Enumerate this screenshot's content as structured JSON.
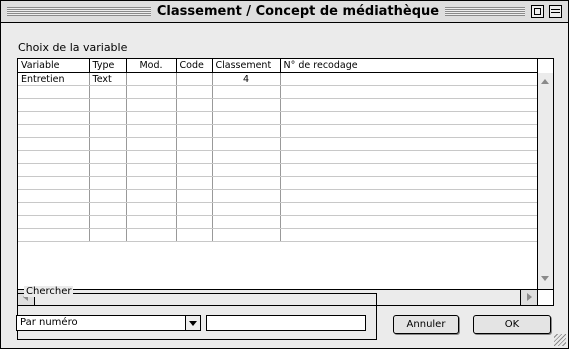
{
  "window": {
    "title": "Classement / Concept de médiathèque"
  },
  "section_label": "Choix de la variable",
  "table": {
    "columns": [
      "Variable",
      "Type",
      "Mod.",
      "Code",
      "Classement",
      "N° de recodage"
    ],
    "rows": [
      {
        "variable": "Entretien",
        "type": "Text",
        "mod": "",
        "code": "",
        "classement": "4",
        "recodage": ""
      }
    ],
    "empty_rows": 12
  },
  "search": {
    "group_label": "Chercher",
    "mode_selected": "Par numéro",
    "value": ""
  },
  "buttons": {
    "cancel": "Annuler",
    "ok": "OK"
  },
  "icons": [
    "zoom-box-icon",
    "collapse-box-icon",
    "scroll-up-arrow-icon",
    "scroll-down-arrow-icon",
    "scroll-left-arrow-icon",
    "scroll-right-arrow-icon",
    "dropdown-arrow-icon",
    "resize-grip-icon"
  ]
}
